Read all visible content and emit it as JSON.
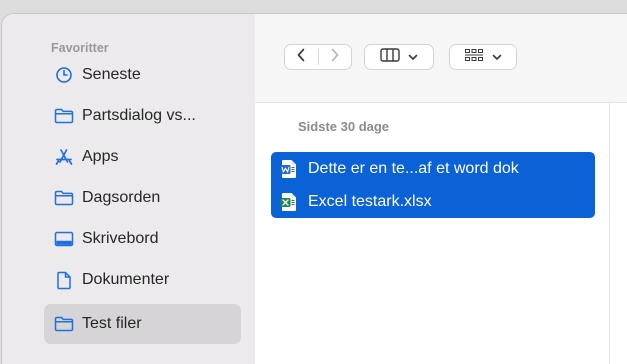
{
  "sidebar": {
    "heading": "Favoritter",
    "items": [
      {
        "label": "Seneste",
        "icon": "clock-icon"
      },
      {
        "label": "Partsdialog vs...",
        "icon": "folder-icon"
      },
      {
        "label": "Apps",
        "icon": "apps-icon"
      },
      {
        "label": "Dagsorden",
        "icon": "folder-icon"
      },
      {
        "label": "Skrivebord",
        "icon": "desktop-icon"
      },
      {
        "label": "Dokumenter",
        "icon": "document-icon"
      },
      {
        "label": "Test filer",
        "icon": "folder-icon",
        "selected": true
      }
    ]
  },
  "toolbar": {
    "back": "back-chevron-icon",
    "forward": "forward-chevron-icon",
    "view": "column-view-icon",
    "group": "group-grid-icon"
  },
  "main": {
    "section_header": "Sidste 30 dage",
    "files": [
      {
        "name": "Dette er en te...af et word dok",
        "icon": "word-doc-icon",
        "selected": true
      },
      {
        "name": "Excel testark.xlsx",
        "icon": "excel-sheet-icon",
        "selected": true
      }
    ]
  },
  "colors": {
    "accent": "#0a62d6",
    "sidebar_bg": "#eceaec",
    "sidebar_icon": "#1f6fe0",
    "word": "#2b66c8",
    "excel": "#1f8a4c"
  }
}
